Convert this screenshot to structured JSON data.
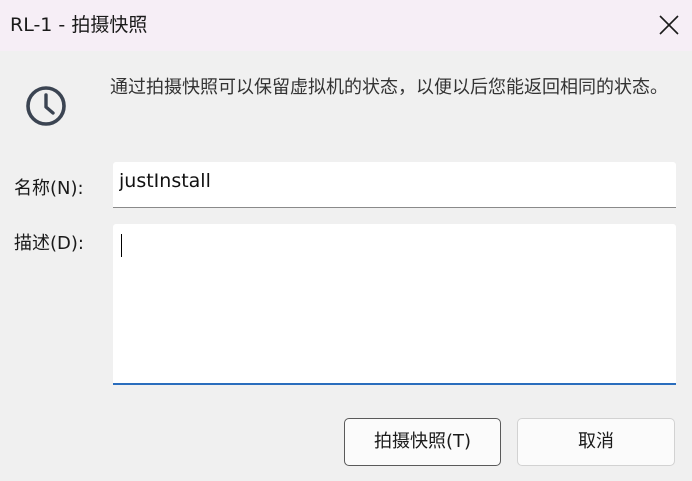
{
  "window": {
    "title": "RL-1 - 拍摄快照"
  },
  "message": "通过拍摄快照可以保留虚拟机的状态，以便以后您能返回相同的状态。",
  "form": {
    "name_label": "名称(N):",
    "name_value": "justInstall",
    "desc_label": "描述(D):",
    "desc_value": ""
  },
  "buttons": {
    "snapshot_label": "拍摄快照(T)",
    "cancel_label": "取消"
  },
  "icons": {
    "close": "close-icon",
    "clock": "clock-icon"
  },
  "colors": {
    "titlebar": "#f6eef6",
    "body": "#f0f0f0",
    "focus_accent": "#2a6dbd"
  }
}
